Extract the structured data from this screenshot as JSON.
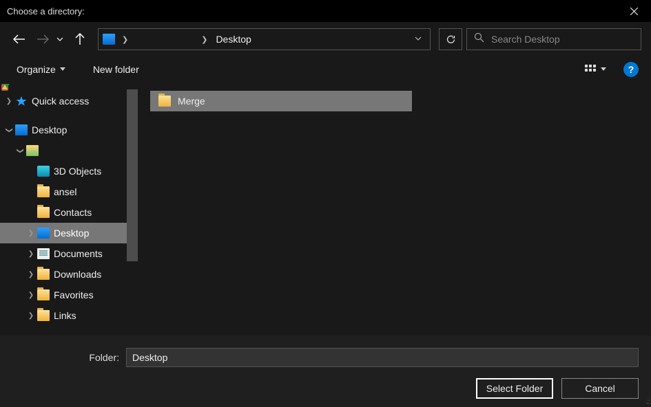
{
  "title": "Choose a directory:",
  "breadcrumb": {
    "segment": "Desktop"
  },
  "search": {
    "placeholder": "Search Desktop"
  },
  "commands": {
    "organize": "Organize",
    "newFolder": "New folder",
    "help": "?"
  },
  "tree": {
    "quickAccess": "Quick access",
    "desktop": "Desktop",
    "items": [
      {
        "label": "3D Objects"
      },
      {
        "label": "ansel"
      },
      {
        "label": "Contacts"
      },
      {
        "label": "Desktop"
      },
      {
        "label": "Documents"
      },
      {
        "label": "Downloads"
      },
      {
        "label": "Favorites"
      },
      {
        "label": "Links"
      }
    ]
  },
  "content": {
    "items": [
      {
        "label": "Merge",
        "type": "folder",
        "selected": true
      }
    ]
  },
  "footer": {
    "folderLabel": "Folder:",
    "folderValue": "Desktop",
    "selectBtn": "Select Folder",
    "cancelBtn": "Cancel"
  }
}
